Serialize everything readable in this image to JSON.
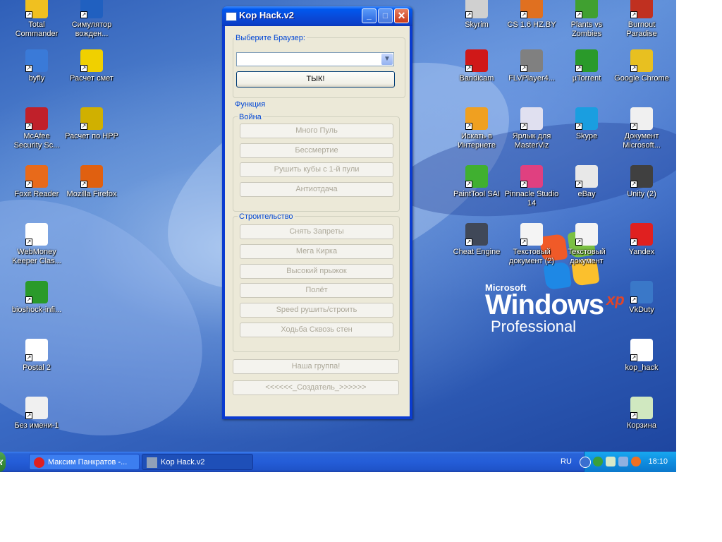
{
  "desktop": {
    "icons": [
      {
        "label": "Total\nCommander",
        "icon": "total-commander-icon",
        "color": "#f0c020"
      },
      {
        "label": "Симулятор\nвожден...",
        "icon": "driving-sim-icon",
        "color": "#2060c0"
      },
      {
        "label": "byfly",
        "icon": "byfly-icon",
        "color": "#3a7ad8"
      },
      {
        "label": "Расчет смет",
        "icon": "hardhat-icon",
        "color": "#f0d000"
      },
      {
        "label": "McAfee\nSecurity Sc...",
        "icon": "mcafee-icon",
        "color": "#c0202a"
      },
      {
        "label": "Расчет по HPP",
        "icon": "worker-icon",
        "color": "#d0b000"
      },
      {
        "label": "Foxit Reader",
        "icon": "foxit-icon",
        "color": "#e86a1a"
      },
      {
        "label": "Mozilla Firefox",
        "icon": "firefox-icon",
        "color": "#e06010"
      },
      {
        "label": "WebMoney\nKeeper Clas...",
        "icon": "webmoney-icon",
        "color": "#ffffff"
      },
      {
        "label": "bioshock-infi...",
        "icon": "utorrent-icon",
        "color": "#2a9a2a"
      },
      {
        "label": "Postal 2",
        "icon": "postal-icon",
        "color": "#ffffff"
      },
      {
        "label": "Без имени-1",
        "icon": "paint-file-icon",
        "color": "#f0f0f0"
      },
      {
        "label": "Skyrim",
        "icon": "skyrim-icon",
        "color": "#d0d0d0"
      },
      {
        "label": "CS 1.6 HZ.BY",
        "icon": "cs-icon",
        "color": "#e07020"
      },
      {
        "label": "Plants vs\nZombies",
        "icon": "pvz-icon",
        "color": "#40a030"
      },
      {
        "label": "Burnout\nParadise",
        "icon": "burnout-icon",
        "color": "#c03020"
      },
      {
        "label": "Bandicam",
        "icon": "bandicam-icon",
        "color": "#d01818"
      },
      {
        "label": "FLVPlayer4...",
        "icon": "flvplayer-icon",
        "color": "#808080"
      },
      {
        "label": "µTorrent",
        "icon": "utorrent-icon",
        "color": "#2a9a2a"
      },
      {
        "label": "Google Chrome",
        "icon": "chrome-icon",
        "color": "#e8c020"
      },
      {
        "label": "Искать в\nИнтернете",
        "icon": "search-web-icon",
        "color": "#f0a020"
      },
      {
        "label": "Ярлык для\nMasterViz",
        "icon": "masterviz-icon",
        "color": "#e0e0f0"
      },
      {
        "label": "Skype",
        "icon": "skype-icon",
        "color": "#1a9ee0"
      },
      {
        "label": "Документ\nMicrosoft...",
        "icon": "word-doc-icon",
        "color": "#f0f0f0"
      },
      {
        "label": "PaintTool SAI",
        "icon": "painttool-icon",
        "color": "#40b030"
      },
      {
        "label": "Pinnacle Studio\n14",
        "icon": "pinnacle-icon",
        "color": "#e04080"
      },
      {
        "label": "eBay",
        "icon": "ebay-icon",
        "color": "#e8e8e8"
      },
      {
        "label": "Unity (2)",
        "icon": "unity-icon",
        "color": "#404040"
      },
      {
        "label": "Cheat Engine",
        "icon": "cheat-engine-icon",
        "color": "#404858"
      },
      {
        "label": "Текстовый\nдокумент (2)",
        "icon": "text-doc-icon",
        "color": "#f4f4f4"
      },
      {
        "label": "Текстовый\nдокумент",
        "icon": "text-doc-icon",
        "color": "#f4f4f4"
      },
      {
        "label": "Yandex",
        "icon": "yandex-icon",
        "color": "#e02020"
      },
      {
        "label": "VkDuty",
        "icon": "vkduty-icon",
        "color": "#3a78c8"
      },
      {
        "label": "kop_hack",
        "icon": "kop-hack-icon",
        "color": "#ffffff"
      },
      {
        "label": "Корзина",
        "icon": "recycle-bin-icon",
        "color": "#d0e8c0"
      }
    ],
    "logo": {
      "microsoft": "Microsoft",
      "windows": "Windows",
      "xp": "xp",
      "edition": "Professional"
    }
  },
  "window": {
    "title": "Kop Hack.v2",
    "browser_group": {
      "label": "Выберите Браузер:",
      "combo_value": "",
      "go_button": "ТЫК!"
    },
    "functions_label": "Функция",
    "war": {
      "label": "Война",
      "buttons": [
        "Много Пуль",
        "Бессмертие",
        "Рушить кубы с 1-й пули",
        "Антиотдача"
      ]
    },
    "build": {
      "label": "Строительство",
      "buttons": [
        "Снять Запреты",
        "Мега Кирка",
        "Высокий прыжок",
        "Полёт",
        "Speed рушить/строить",
        "Ходьба Сквозь стен"
      ]
    },
    "group_button": "Наша группа!",
    "creator_button": "<<<<<<_Создатель_>>>>>>"
  },
  "taskbar": {
    "start_label": "к",
    "items": [
      {
        "label": "Максим Панкратов -...",
        "icon": "yandex-browser-icon"
      },
      {
        "label": "Kop Hack.v2",
        "icon": "kop-hack-icon"
      }
    ],
    "language": "RU",
    "clock": "18:10"
  }
}
